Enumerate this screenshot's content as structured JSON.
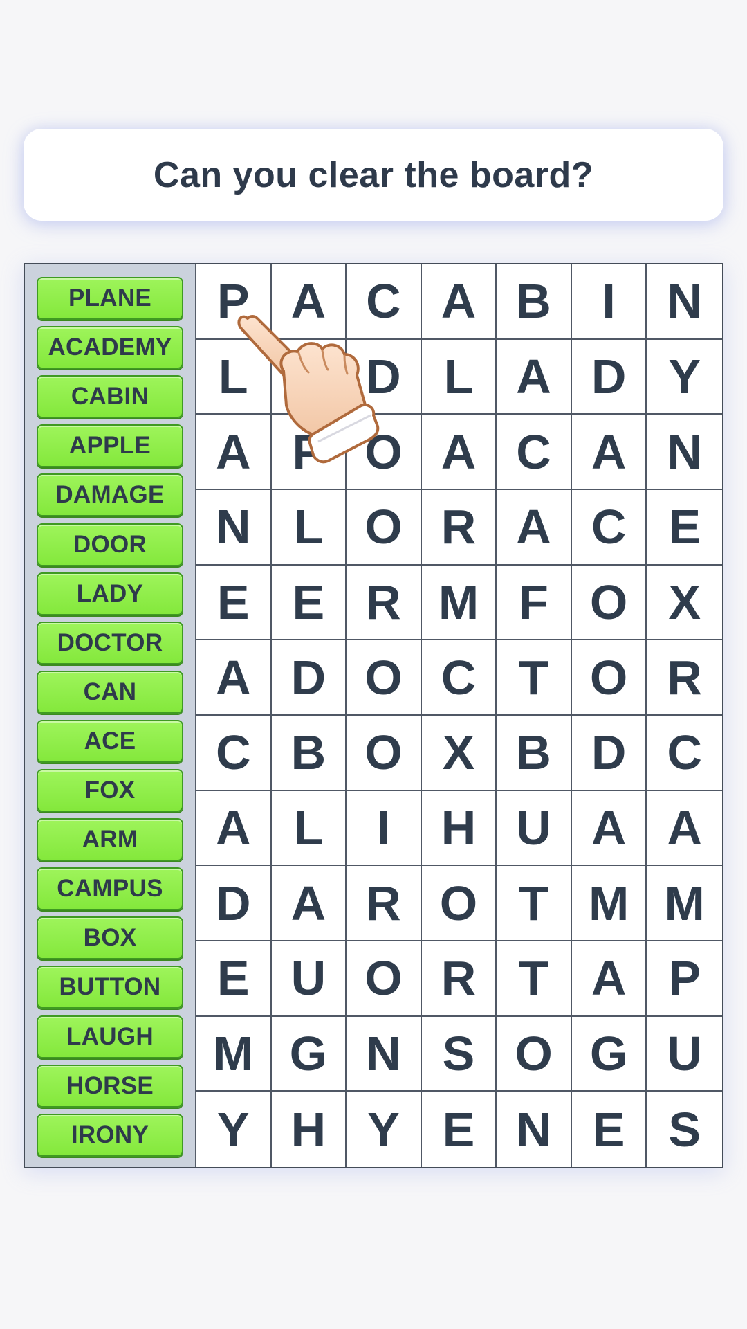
{
  "title": "Can you clear the board?",
  "words": [
    "PLANE",
    "ACADEMY",
    "CABIN",
    "APPLE",
    "DAMAGE",
    "DOOR",
    "LADY",
    "DOCTOR",
    "CAN",
    "ACE",
    "FOX",
    "ARM",
    "CAMPUS",
    "BOX",
    "BUTTON",
    "LAUGH",
    "HORSE",
    "IRONY"
  ],
  "grid": [
    [
      "P",
      "A",
      "C",
      "A",
      "B",
      "I",
      "N"
    ],
    [
      "L",
      "",
      "D",
      "L",
      "A",
      "D",
      "Y"
    ],
    [
      "A",
      "P",
      "O",
      "A",
      "C",
      "A",
      "N"
    ],
    [
      "N",
      "L",
      "O",
      "R",
      "A",
      "C",
      "E"
    ],
    [
      "E",
      "E",
      "R",
      "M",
      "F",
      "O",
      "X"
    ],
    [
      "A",
      "D",
      "O",
      "C",
      "T",
      "O",
      "R"
    ],
    [
      "C",
      "B",
      "O",
      "X",
      "B",
      "D",
      "C"
    ],
    [
      "A",
      "L",
      "I",
      "H",
      "U",
      "A",
      "A"
    ],
    [
      "D",
      "A",
      "R",
      "O",
      "T",
      "M",
      "M"
    ],
    [
      "E",
      "U",
      "O",
      "R",
      "T",
      "A",
      "P"
    ],
    [
      "M",
      "G",
      "N",
      "S",
      "O",
      "G",
      "U"
    ],
    [
      "Y",
      "H",
      "Y",
      "E",
      "N",
      "E",
      "S"
    ]
  ],
  "colors": {
    "background": "#f6f6f8",
    "chip": "#8fee4a",
    "text": "#2e3a4b",
    "panel": "#cbd2dd"
  },
  "icons": {
    "tutorial_hand": "pointing-hand-icon"
  }
}
